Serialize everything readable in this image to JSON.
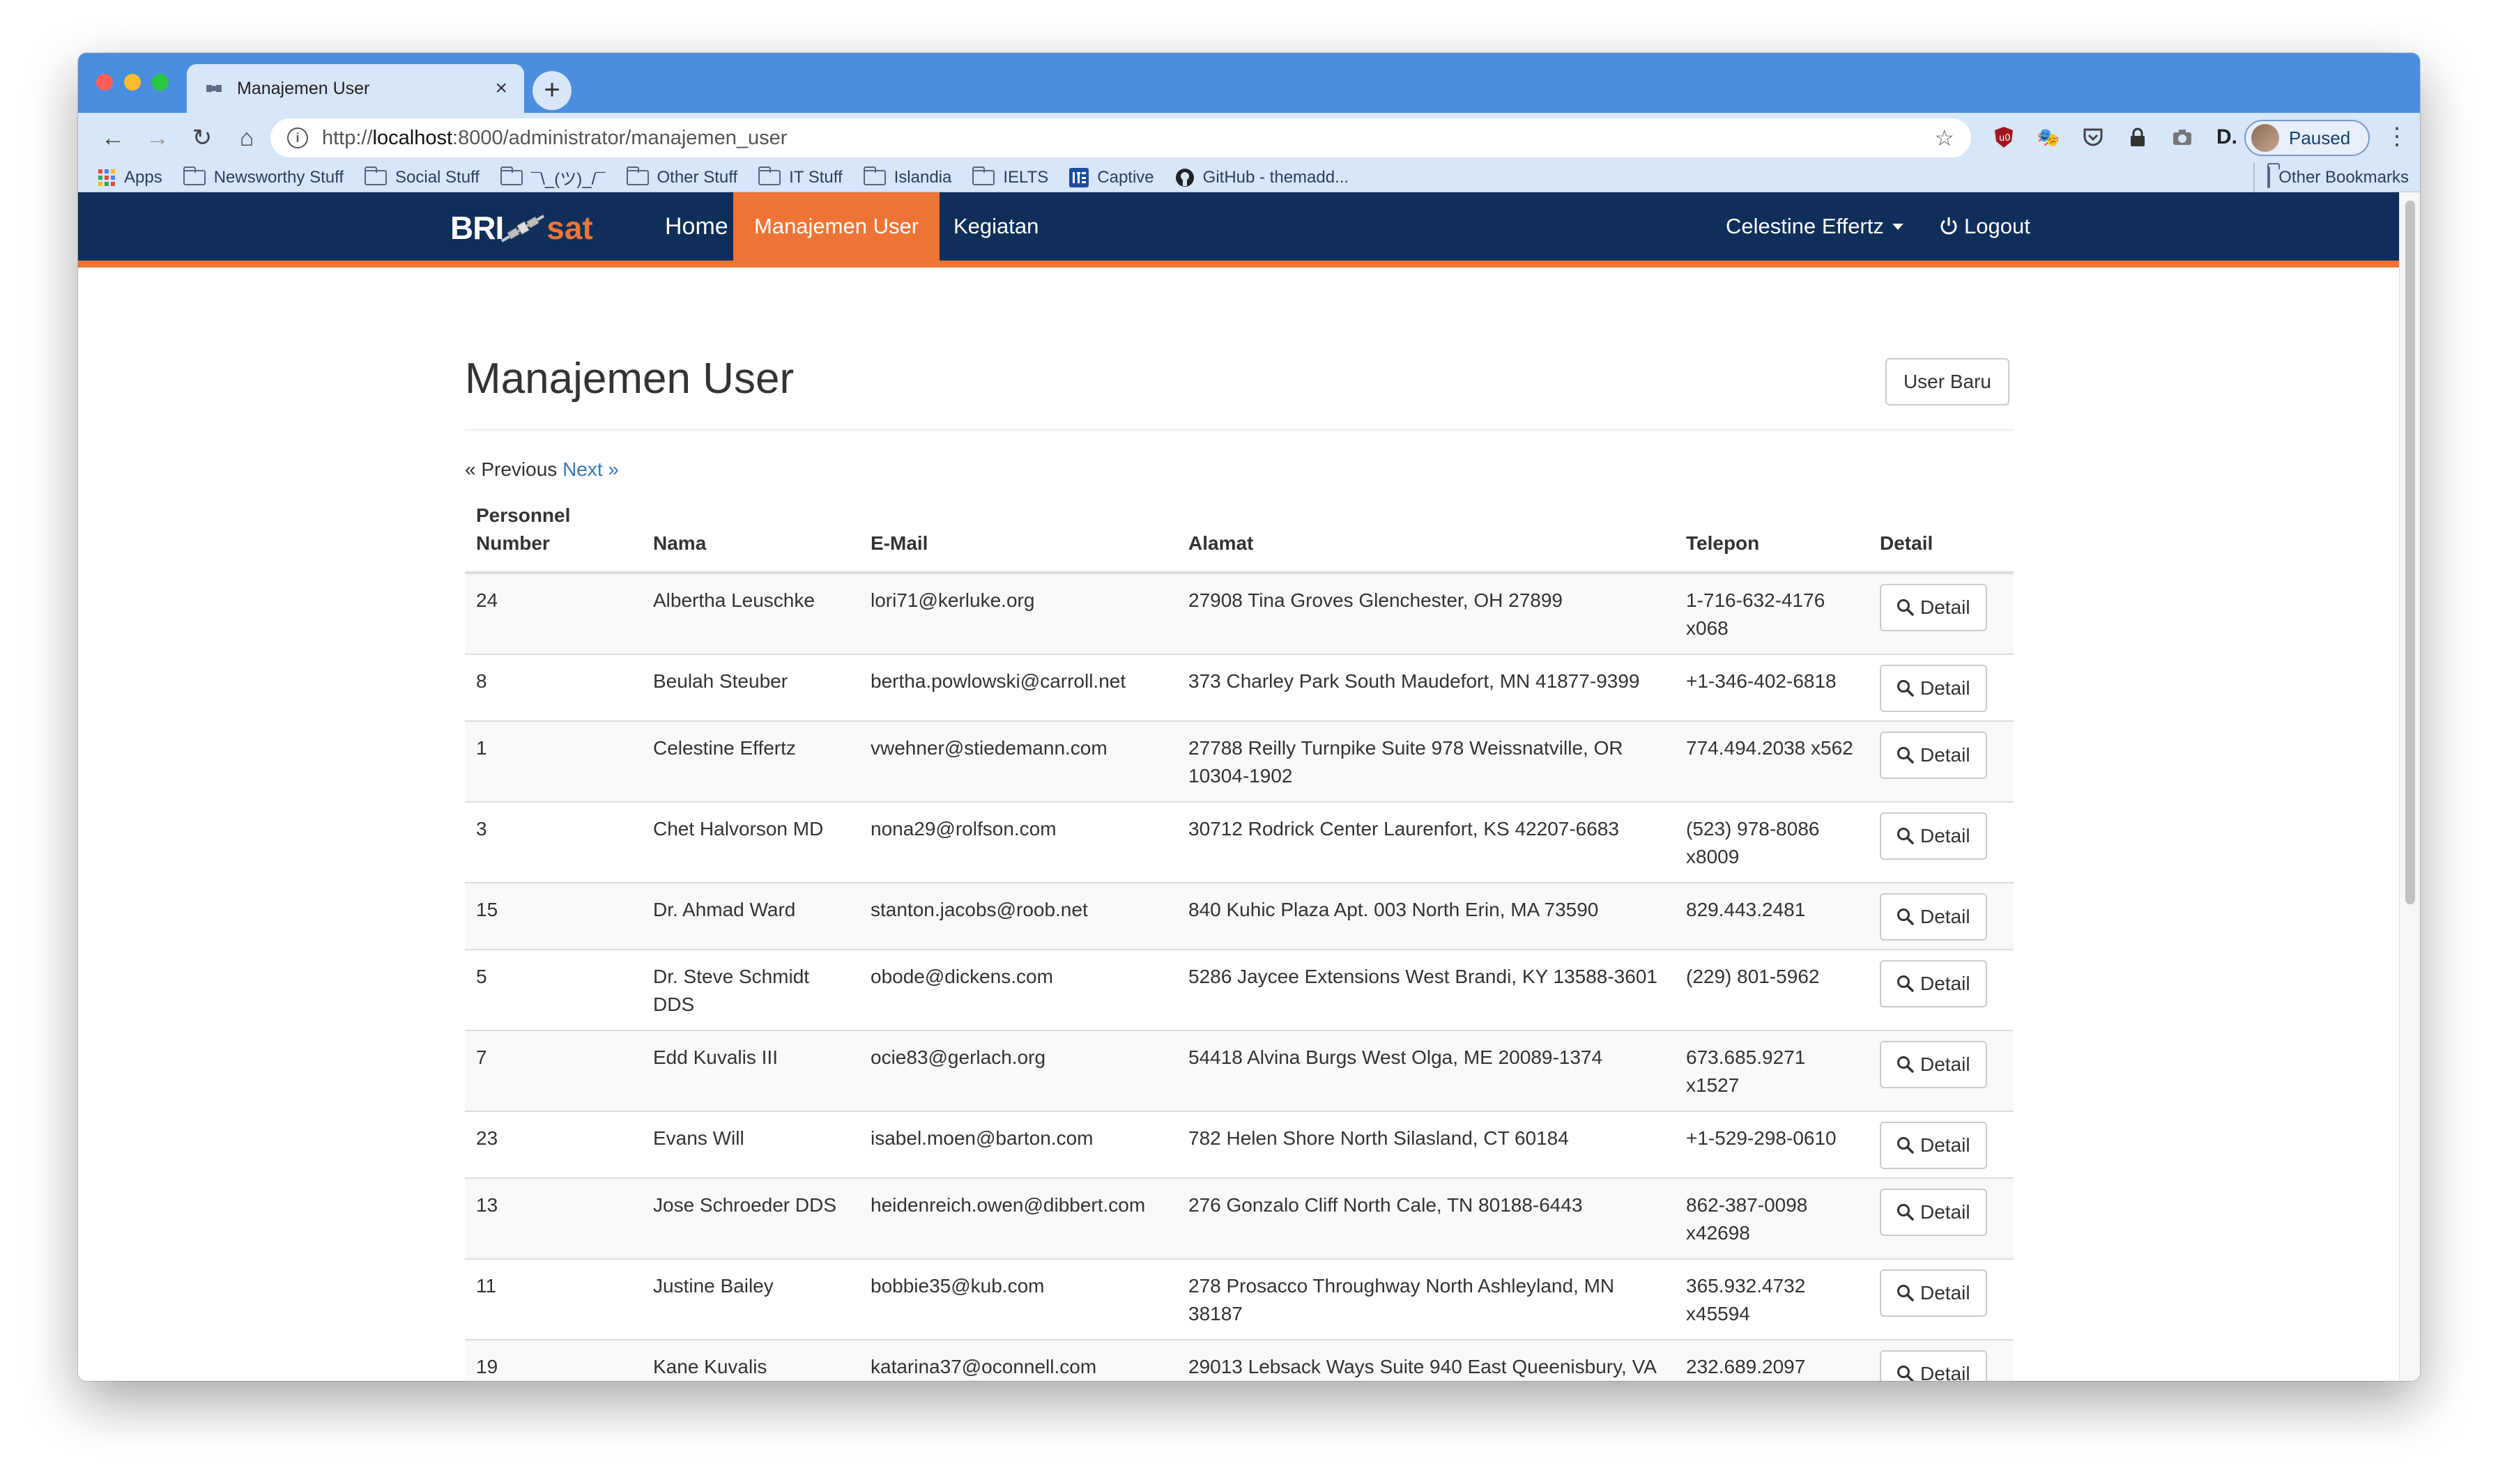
{
  "browser": {
    "tab_title": "Manajemen User",
    "url_prefix": "http://",
    "url_host": "localhost",
    "url_rest": ":8000/administrator/manajemen_user",
    "profile_label": "Paused",
    "bookmarks": [
      "Apps",
      "Newsworthy Stuff",
      "Social Stuff",
      "¯\\_(ツ)_/¯",
      "Other Stuff",
      "IT Stuff",
      "Islandia",
      "IELTS",
      "Captive",
      "GitHub - themadd..."
    ],
    "other_bookmarks": "Other Bookmarks"
  },
  "navbar": {
    "brand_left": "BRI",
    "brand_right": "sat",
    "home": "Home",
    "manajemen_user": "Manajemen User",
    "kegiatan": "Kegiatan",
    "user_name": "Celestine Effertz",
    "logout": "Logout",
    "accent": "#ee7436",
    "bg": "#0f2f5a"
  },
  "main": {
    "title": "Manajemen User",
    "new_user_button": "User Baru",
    "pager_prev": "« Previous",
    "pager_next": "Next »",
    "columns": [
      "Personnel Number",
      "Nama",
      "E-Mail",
      "Alamat",
      "Telepon",
      "Detail"
    ],
    "detail_label": "Detail",
    "rows": [
      {
        "id": "24",
        "nama": "Albertha Leuschke",
        "email": "lori71@kerluke.org",
        "alamat": "27908 Tina Groves Glenchester, OH 27899",
        "telepon": "1-716-632-4176 x068"
      },
      {
        "id": "8",
        "nama": "Beulah Steuber",
        "email": "bertha.powlowski@carroll.net",
        "alamat": "373 Charley Park South Maudefort, MN 41877-9399",
        "telepon": "+1-346-402-6818"
      },
      {
        "id": "1",
        "nama": "Celestine Effertz",
        "email": "vwehner@stiedemann.com",
        "alamat": "27788 Reilly Turnpike Suite 978 Weissnatville, OR 10304-1902",
        "telepon": "774.494.2038 x562"
      },
      {
        "id": "3",
        "nama": "Chet Halvorson MD",
        "email": "nona29@rolfson.com",
        "alamat": "30712 Rodrick Center Laurenfort, KS 42207-6683",
        "telepon": "(523) 978-8086 x8009"
      },
      {
        "id": "15",
        "nama": "Dr. Ahmad Ward",
        "email": "stanton.jacobs@roob.net",
        "alamat": "840 Kuhic Plaza Apt. 003 North Erin, MA 73590",
        "telepon": "829.443.2481"
      },
      {
        "id": "5",
        "nama": "Dr. Steve Schmidt DDS",
        "email": "obode@dickens.com",
        "alamat": "5286 Jaycee Extensions West Brandi, KY 13588-3601",
        "telepon": "(229) 801-5962"
      },
      {
        "id": "7",
        "nama": "Edd Kuvalis III",
        "email": "ocie83@gerlach.org",
        "alamat": "54418 Alvina Burgs West Olga, ME 20089-1374",
        "telepon": "673.685.9271 x1527"
      },
      {
        "id": "23",
        "nama": "Evans Will",
        "email": "isabel.moen@barton.com",
        "alamat": "782 Helen Shore North Silasland, CT 60184",
        "telepon": "+1-529-298-0610"
      },
      {
        "id": "13",
        "nama": "Jose Schroeder DDS",
        "email": "heidenreich.owen@dibbert.com",
        "alamat": "276 Gonzalo Cliff North Cale, TN 80188-6443",
        "telepon": "862-387-0098 x42698"
      },
      {
        "id": "11",
        "nama": "Justine Bailey",
        "email": "bobbie35@kub.com",
        "alamat": "278 Prosacco Throughway North Ashleyland, MN 38187",
        "telepon": "365.932.4732 x45594"
      },
      {
        "id": "19",
        "nama": "Kane Kuvalis",
        "email": "katarina37@oconnell.com",
        "alamat": "29013 Lebsack Ways Suite 940 East Queenisbury, VA",
        "telepon": "232.689.2097"
      }
    ]
  }
}
